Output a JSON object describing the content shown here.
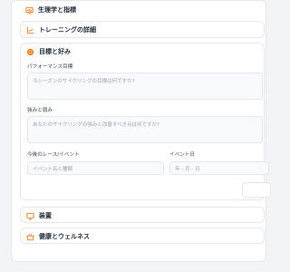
{
  "sections": {
    "physiology": {
      "title": "生理学と指標"
    },
    "training": {
      "title": "トレーニングの詳細"
    },
    "goals": {
      "title": "目標と好み",
      "performance_label": "パフォーマンス目標",
      "performance_placeholder": "今シーズンのサイクリングの目標は何ですか?",
      "strengths_label": "強みと弱み",
      "strengths_placeholder": "あなたのサイクリングの強みと改善すべき点は何ですか?",
      "race_label": "今後のレース/イベント",
      "race_placeholder": "イベント名と種類",
      "date_label": "イベント日",
      "date_placeholder": "年 - 月 - 日"
    },
    "equipment": {
      "title": "装置"
    },
    "wellness": {
      "title": "健康とウェルネス"
    }
  },
  "colors": {
    "accent": "#f97316",
    "border": "#e5e7eb",
    "field_bg": "#f9fafb"
  },
  "icons": {
    "physiology": "heart-monitor-icon",
    "training": "line-chart-icon",
    "goals": "target-icon",
    "equipment": "monitor-icon",
    "wellness": "basket-icon"
  }
}
